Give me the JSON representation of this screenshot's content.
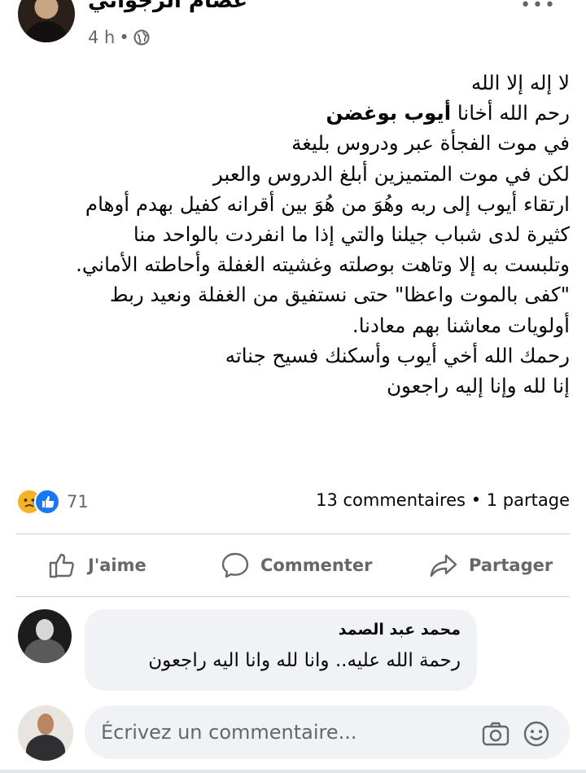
{
  "post": {
    "author": "عصام الزجواني",
    "time": "4 h",
    "time_separator": "•",
    "lines": [
      {
        "text": "لا إله إلا الله"
      },
      {
        "prefix": "رحم الله أخانا ",
        "bold": "أيوب بوغضن"
      },
      {
        "text": "في موت الفجأة عبر ودروس بليغة"
      },
      {
        "text": "لكن في موت المتميزين أبلغ الدروس والعبر"
      },
      {
        "text": "ارتقاء أيوب إلى ربه وهُوَ من هُوَ بين أقرانه كفيل بهدم أوهام"
      },
      {
        "text": "كثيرة لدى شباب جيلنا والتي إذا ما انفردت بالواحد منا"
      },
      {
        "text": "وتلبست به إلا وتاهت بوصلته وغشيته الغفلة وأحاطته الأماني."
      },
      {
        "text": "\"كفى بالموت واعظا\" حتى نستفيق من الغفلة ونعيد ربط"
      },
      {
        "text": "أولويات معاشنا بهم معادنا."
      },
      {
        "text": "رحمك الله أخي أيوب وأسكنك فسيح جناته"
      },
      {
        "text": "إنا لله وإنا إليه راجعون"
      }
    ]
  },
  "reactions": {
    "count": "71",
    "types": [
      "sad",
      "like"
    ]
  },
  "stats": {
    "comments": "13 commentaires",
    "separator": "•",
    "shares": "1 partage"
  },
  "actions": {
    "like": "J'aime",
    "comment": "Commenter",
    "share": "Partager"
  },
  "comments": [
    {
      "author": "محمد عبد الصمد",
      "text": "رحمة الله عليه.. وانا لله وانا اليه راجعون"
    }
  ],
  "composer": {
    "placeholder": "Écrivez un commentaire..."
  },
  "icons": {
    "globe": "globe-icon",
    "like": "thumbs-up-icon",
    "comment": "speech-bubble-icon",
    "share": "share-arrow-icon",
    "camera": "camera-icon",
    "emoji": "emoji-icon",
    "more": "more-icon"
  },
  "colors": {
    "text": "#050505",
    "secondary": "#65676b",
    "bubble": "#f0f2f5",
    "like_blue": "#1877f2",
    "sad_yellow": "#f7b125",
    "divider": "#ced0d4"
  }
}
